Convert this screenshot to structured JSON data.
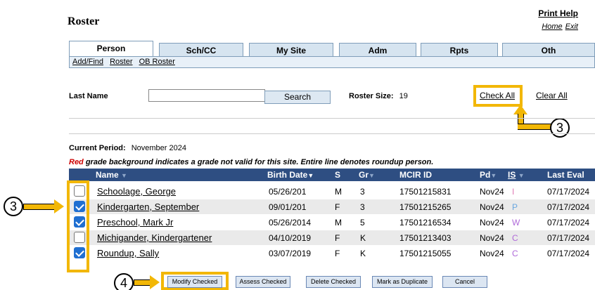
{
  "top_cut_text": "",
  "header": {
    "title": "Roster",
    "print_help": "Print Help",
    "home": "Home",
    "exit": "Exit"
  },
  "tabs": [
    "Person",
    "Sch/CC",
    "My Site",
    "Adm",
    "Rpts",
    "Oth"
  ],
  "subnav": [
    "Add/Find",
    "Roster",
    "OB Roster"
  ],
  "search": {
    "label": "Last Name",
    "value": "",
    "button": "Search",
    "roster_size_label": "Roster Size:",
    "roster_size": "19",
    "check_all": "Check All",
    "clear_all": "Clear All"
  },
  "period": {
    "label": "Current Period:",
    "value": "November 2024"
  },
  "note": {
    "red": "Red",
    "rest": " grade background indicates a grade not valid for this site. Entire line denotes roundup person."
  },
  "table": {
    "headers": [
      "Name",
      "Birth Date",
      "S",
      "Gr",
      "MCIR ID",
      "Pd",
      "IS",
      "Last Eval"
    ],
    "rows": [
      {
        "checked": false,
        "name": "Schoolage, George",
        "birth": "05/26/201",
        "s": "M",
        "gr": "3",
        "mcir": "17501215831",
        "pd": "Nov24",
        "is": "I",
        "eval": "07/17/2024"
      },
      {
        "checked": true,
        "name": "Kindergarten, September",
        "birth": "09/01/201",
        "s": "F",
        "gr": "3",
        "mcir": "17501215265",
        "pd": "Nov24",
        "is": "P",
        "eval": "07/17/2024"
      },
      {
        "checked": true,
        "name": "Preschool, Mark Jr",
        "birth": "05/26/2014",
        "s": "M",
        "gr": "5",
        "mcir": "17501216534",
        "pd": "Nov24",
        "is": "W",
        "eval": "07/17/2024"
      },
      {
        "checked": false,
        "name": "Michigander, Kindergartener",
        "birth": "04/10/2019",
        "s": "F",
        "gr": "K",
        "mcir": "17501213403",
        "pd": "Nov24",
        "is": "C",
        "eval": "07/17/2024"
      },
      {
        "checked": true,
        "name": "Roundup, Sally",
        "birth": "03/07/2019",
        "s": "F",
        "gr": "K",
        "mcir": "17501215055",
        "pd": "Nov24",
        "is": "C",
        "eval": "07/17/2024"
      }
    ]
  },
  "buttons": [
    "Modify Checked",
    "Assess Checked",
    "Delete Checked",
    "Mark as Duplicate",
    "Cancel"
  ],
  "callouts": {
    "check_all": "3",
    "checkbox": "3",
    "modify": "4"
  },
  "colors": {
    "highlight": "#f2b705",
    "header_bg": "#2e4e82",
    "checkbox_on": "#1f6fd1"
  }
}
